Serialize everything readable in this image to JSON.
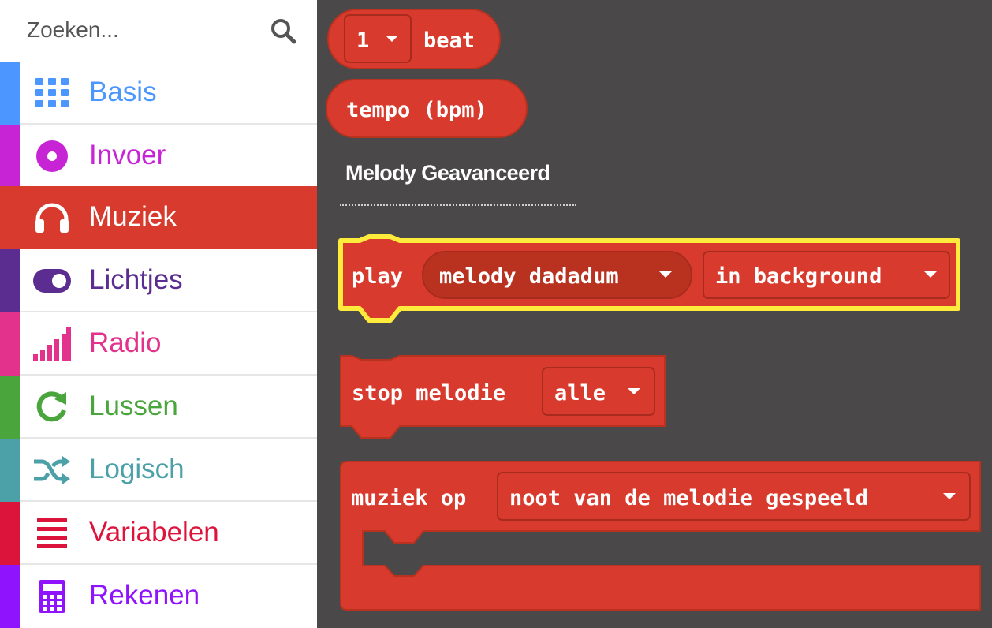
{
  "search": {
    "placeholder": "Zoeken...",
    "icon": "search-icon"
  },
  "categories": [
    {
      "label": "Basis",
      "color": "#4c97ff",
      "icon": "grid-icon"
    },
    {
      "label": "Invoer",
      "color": "#c724d6",
      "icon": "target-circle-icon"
    },
    {
      "label": "Muziek",
      "color": "#d83b2d",
      "icon": "headphones-icon",
      "selected": true
    },
    {
      "label": "Lichtjes",
      "color": "#5c2d91",
      "icon": "toggle-icon"
    },
    {
      "label": "Radio",
      "color": "#e3328b",
      "icon": "signal-bars-icon"
    },
    {
      "label": "Lussen",
      "color": "#4aa53d",
      "icon": "refresh-icon"
    },
    {
      "label": "Logisch",
      "color": "#4ca1a8",
      "icon": "shuffle-icon"
    },
    {
      "label": "Variabelen",
      "color": "#dc143c",
      "icon": "list-icon"
    },
    {
      "label": "Rekenen",
      "color": "#9013fe",
      "icon": "calculator-icon"
    }
  ],
  "workspace": {
    "block_color": "#d83b2d",
    "beat_block": {
      "value": "1",
      "label": "beat"
    },
    "tempo_block": {
      "label": "tempo (bpm)"
    },
    "section_heading": "Melody Geavanceerd",
    "play_block": {
      "label": "play",
      "melody": "melody dadadum",
      "mode": "in background"
    },
    "stop_block": {
      "label": "stop melodie",
      "option": "alle"
    },
    "event_block": {
      "label": "muziek op",
      "option": "noot van de melodie gespeeld"
    }
  }
}
